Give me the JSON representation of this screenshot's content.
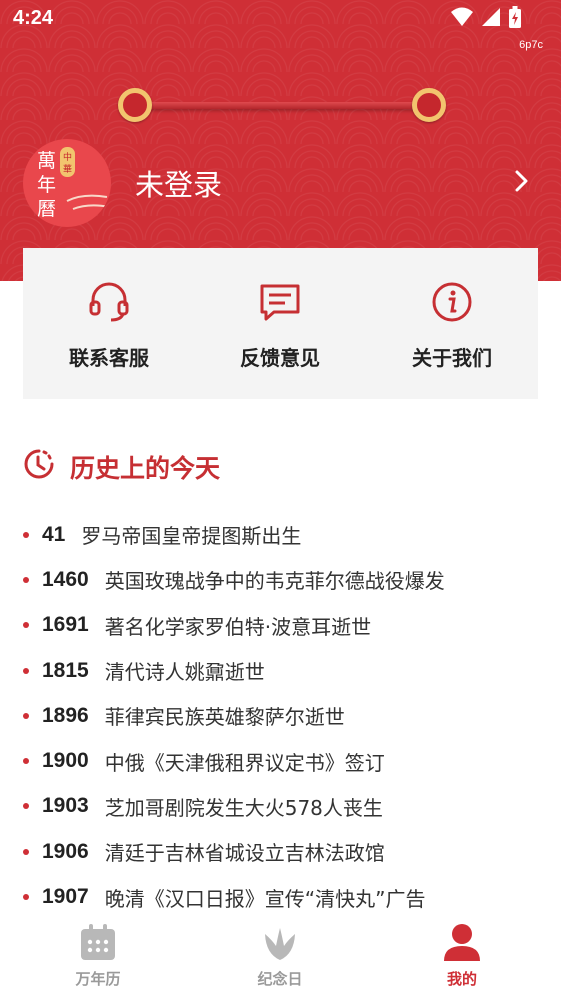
{
  "status_bar": {
    "time": "4:24",
    "tag": "6p7c"
  },
  "profile": {
    "name": "未登录",
    "avatar_text": [
      "萬",
      "年",
      "曆"
    ],
    "avatar_badge": "中華"
  },
  "services": [
    {
      "label": "联系客服",
      "icon": "headset-icon"
    },
    {
      "label": "反馈意见",
      "icon": "feedback-icon"
    },
    {
      "label": "关于我们",
      "icon": "info-icon"
    }
  ],
  "history": {
    "title": "历史上的今天",
    "events": [
      {
        "year": "41",
        "text": "罗马帝国皇帝提图斯出生"
      },
      {
        "year": "1460",
        "text": "英国玫瑰战争中的韦克菲尔德战役爆发"
      },
      {
        "year": "1691",
        "text": "著名化学家罗伯特·波意耳逝世"
      },
      {
        "year": "1815",
        "text": "清代诗人姚鼐逝世"
      },
      {
        "year": "1896",
        "text": "菲律宾民族英雄黎萨尔逝世"
      },
      {
        "year": "1900",
        "text": "中俄《天津俄租界议定书》签订"
      },
      {
        "year": "1903",
        "text": "芝加哥剧院发生大火578人丧生"
      },
      {
        "year": "1906",
        "text": "清廷于吉林省城设立吉林法政馆"
      },
      {
        "year": "1907",
        "text": "晚清《汉口日报》宣传“清快丸”广告"
      }
    ]
  },
  "nav": [
    {
      "label": "万年历",
      "active": false,
      "icon": "calendar-icon"
    },
    {
      "label": "纪念日",
      "active": false,
      "icon": "flower-icon"
    },
    {
      "label": "我的",
      "active": true,
      "icon": "person-icon"
    }
  ],
  "colors": {
    "brand_red": "#cf2f36",
    "inactive_gray": "#9a9a9a",
    "card_bg": "#f4f4f4"
  }
}
